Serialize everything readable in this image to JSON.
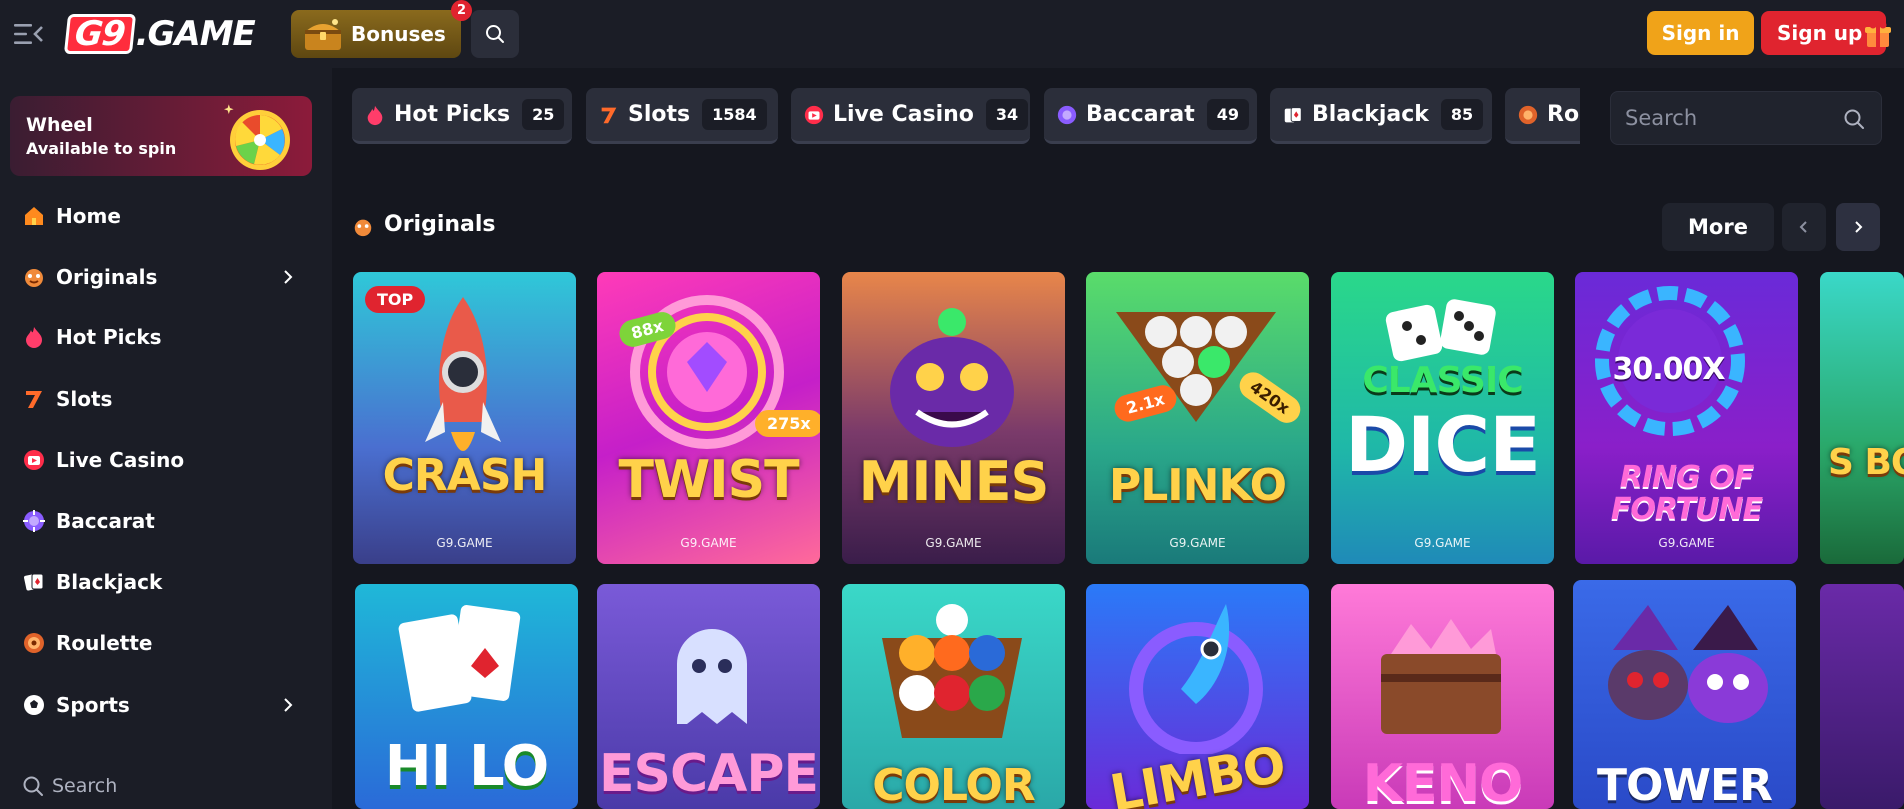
{
  "header": {
    "logo_g9": "G9",
    "logo_rest": ".GAME",
    "bonuses_label": "Bonuses",
    "bonuses_count": "2",
    "signin_label": "Sign in",
    "signup_label": "Sign up"
  },
  "sidebar": {
    "wheel_title": "Wheel",
    "wheel_subtitle": "Available to spin",
    "items": [
      {
        "label": "Home",
        "icon": "home-icon"
      },
      {
        "label": "Originals",
        "icon": "originals-icon"
      },
      {
        "label": "Hot Picks",
        "icon": "flame-icon"
      },
      {
        "label": "Slots",
        "icon": "slot-seven-icon"
      },
      {
        "label": "Live Casino",
        "icon": "live-tv-icon"
      },
      {
        "label": "Baccarat",
        "icon": "baccarat-chip-icon"
      },
      {
        "label": "Blackjack",
        "icon": "cards-icon"
      },
      {
        "label": "Roulette",
        "icon": "roulette-icon"
      },
      {
        "label": "Sports",
        "icon": "football-icon"
      }
    ],
    "search_label": "Search"
  },
  "categories": [
    {
      "label": "Hot Picks",
      "count": "25"
    },
    {
      "label": "Slots",
      "count": "1584"
    },
    {
      "label": "Live Casino",
      "count": "34"
    },
    {
      "label": "Baccarat",
      "count": "49"
    },
    {
      "label": "Blackjack",
      "count": "85"
    },
    {
      "label": "Ro",
      "count": ""
    }
  ],
  "search": {
    "placeholder": "Search"
  },
  "section": {
    "title": "Originals",
    "more_label": "More"
  },
  "games_row1": [
    {
      "name": "CRASH",
      "brand": "G9.GAME",
      "badge": "TOP"
    },
    {
      "name": "TWIST",
      "brand": "G9.GAME",
      "mult1": "88x",
      "mult2": "275x"
    },
    {
      "name": "MINES",
      "brand": "G9.GAME"
    },
    {
      "name": "PLINKO",
      "brand": "G9.GAME",
      "mult1": "2.1x",
      "mult2": "420x"
    },
    {
      "name_top": "CLASSIC",
      "name": "DICE",
      "brand": "G9.GAME"
    },
    {
      "name_top": "RING OF",
      "name": "FORTUNE",
      "brand": "G9.GAME",
      "mult1": "30.00X"
    },
    {
      "name": "S BO"
    }
  ],
  "games_row2": [
    {
      "name": "HI LO"
    },
    {
      "name": "ESCAPE"
    },
    {
      "name": "COLOR"
    },
    {
      "name": "LIMBO"
    },
    {
      "name": "KENO"
    },
    {
      "name": "TOWER"
    }
  ],
  "colors": {
    "background": "#15171f",
    "panel": "#1b1d26",
    "signin": "#f0a319",
    "signup": "#e0242f",
    "tab": "#2b2e3a"
  }
}
